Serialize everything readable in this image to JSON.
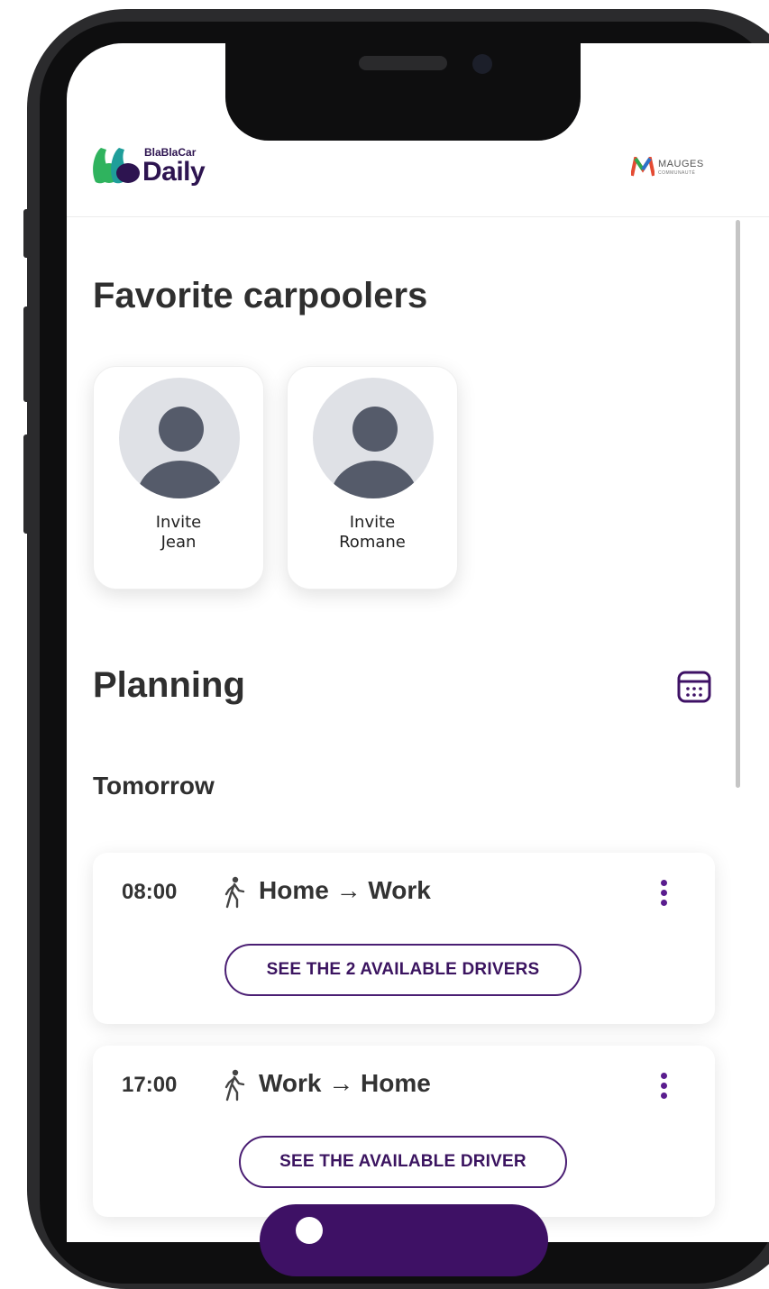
{
  "app": {
    "logo_small": "BlaBlaCar",
    "logo_big": "Daily",
    "partner_name": "MAUGES",
    "partner_sub": "COMMUNAUTÉ"
  },
  "favorites": {
    "title": "Favorite carpoolers",
    "people": [
      {
        "line1": "Invite",
        "line2": "Jean"
      },
      {
        "line1": "Invite",
        "line2": "Romane"
      }
    ]
  },
  "planning": {
    "title": "Planning",
    "day": "Tomorrow",
    "trips": [
      {
        "time": "08:00",
        "route": "Home → Work",
        "button": "SEE THE 2 AVAILABLE DRIVERS"
      },
      {
        "time": "17:00",
        "route": "Work → Home",
        "button": "SEE THE AVAILABLE DRIVER"
      }
    ]
  },
  "colors": {
    "brand_purple": "#3e1165",
    "accent_purple": "#5a1d8e",
    "logo_green": "#2fb35e",
    "logo_teal": "#1f9e9a"
  }
}
